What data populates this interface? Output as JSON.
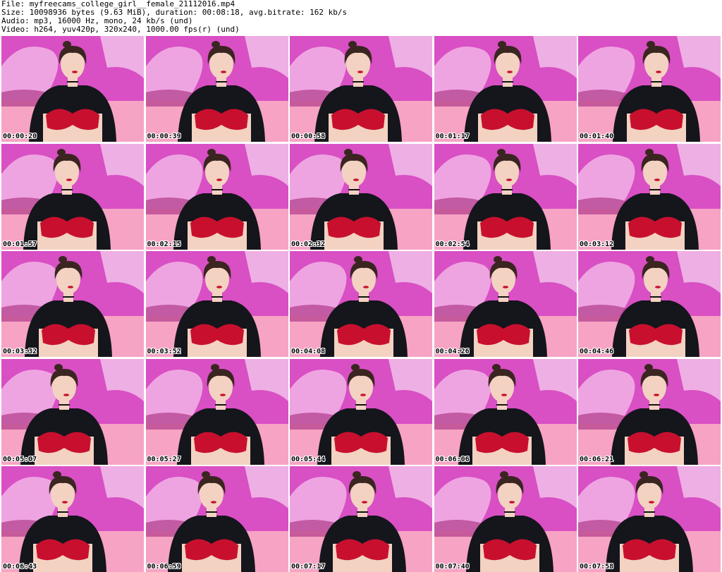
{
  "header": {
    "file_line": "File: myfreecams_college_girl__female_21112016.mp4",
    "size_line": "Size: 10098936 bytes (9.63 MiB), duration: 00:08:18, avg.bitrate: 162 kb/s",
    "audio_line": "Audio: mp3, 16000 Hz, mono, 24 kb/s (und)",
    "video_line": "Video: h264, yuv420p, 320x240, 1000.00 fps(r) (und)"
  },
  "frames": [
    {
      "timestamp": "00:00:20"
    },
    {
      "timestamp": "00:00:39"
    },
    {
      "timestamp": "00:00:58"
    },
    {
      "timestamp": "00:01:17"
    },
    {
      "timestamp": "00:01:40"
    },
    {
      "timestamp": "00:01:57"
    },
    {
      "timestamp": "00:02:15"
    },
    {
      "timestamp": "00:02:32"
    },
    {
      "timestamp": "00:02:54"
    },
    {
      "timestamp": "00:03:12"
    },
    {
      "timestamp": "00:03:32"
    },
    {
      "timestamp": "00:03:52"
    },
    {
      "timestamp": "00:04:08"
    },
    {
      "timestamp": "00:04:26"
    },
    {
      "timestamp": "00:04:46"
    },
    {
      "timestamp": "00:05:07"
    },
    {
      "timestamp": "00:05:27"
    },
    {
      "timestamp": "00:05:44"
    },
    {
      "timestamp": "00:06:06"
    },
    {
      "timestamp": "00:06:21"
    },
    {
      "timestamp": "00:06:43"
    },
    {
      "timestamp": "00:06:59"
    },
    {
      "timestamp": "00:07:17"
    },
    {
      "timestamp": "00:07:40"
    },
    {
      "timestamp": "00:07:58"
    }
  ],
  "colors": {
    "wall_magenta": "#d94fc4",
    "wall_light": "#f2b3e8",
    "couch_pink": "#f7a3c4",
    "top_black": "#15151c",
    "bra_red": "#c8102e",
    "skin": "#f3d2c2",
    "hair": "#3a2520"
  }
}
